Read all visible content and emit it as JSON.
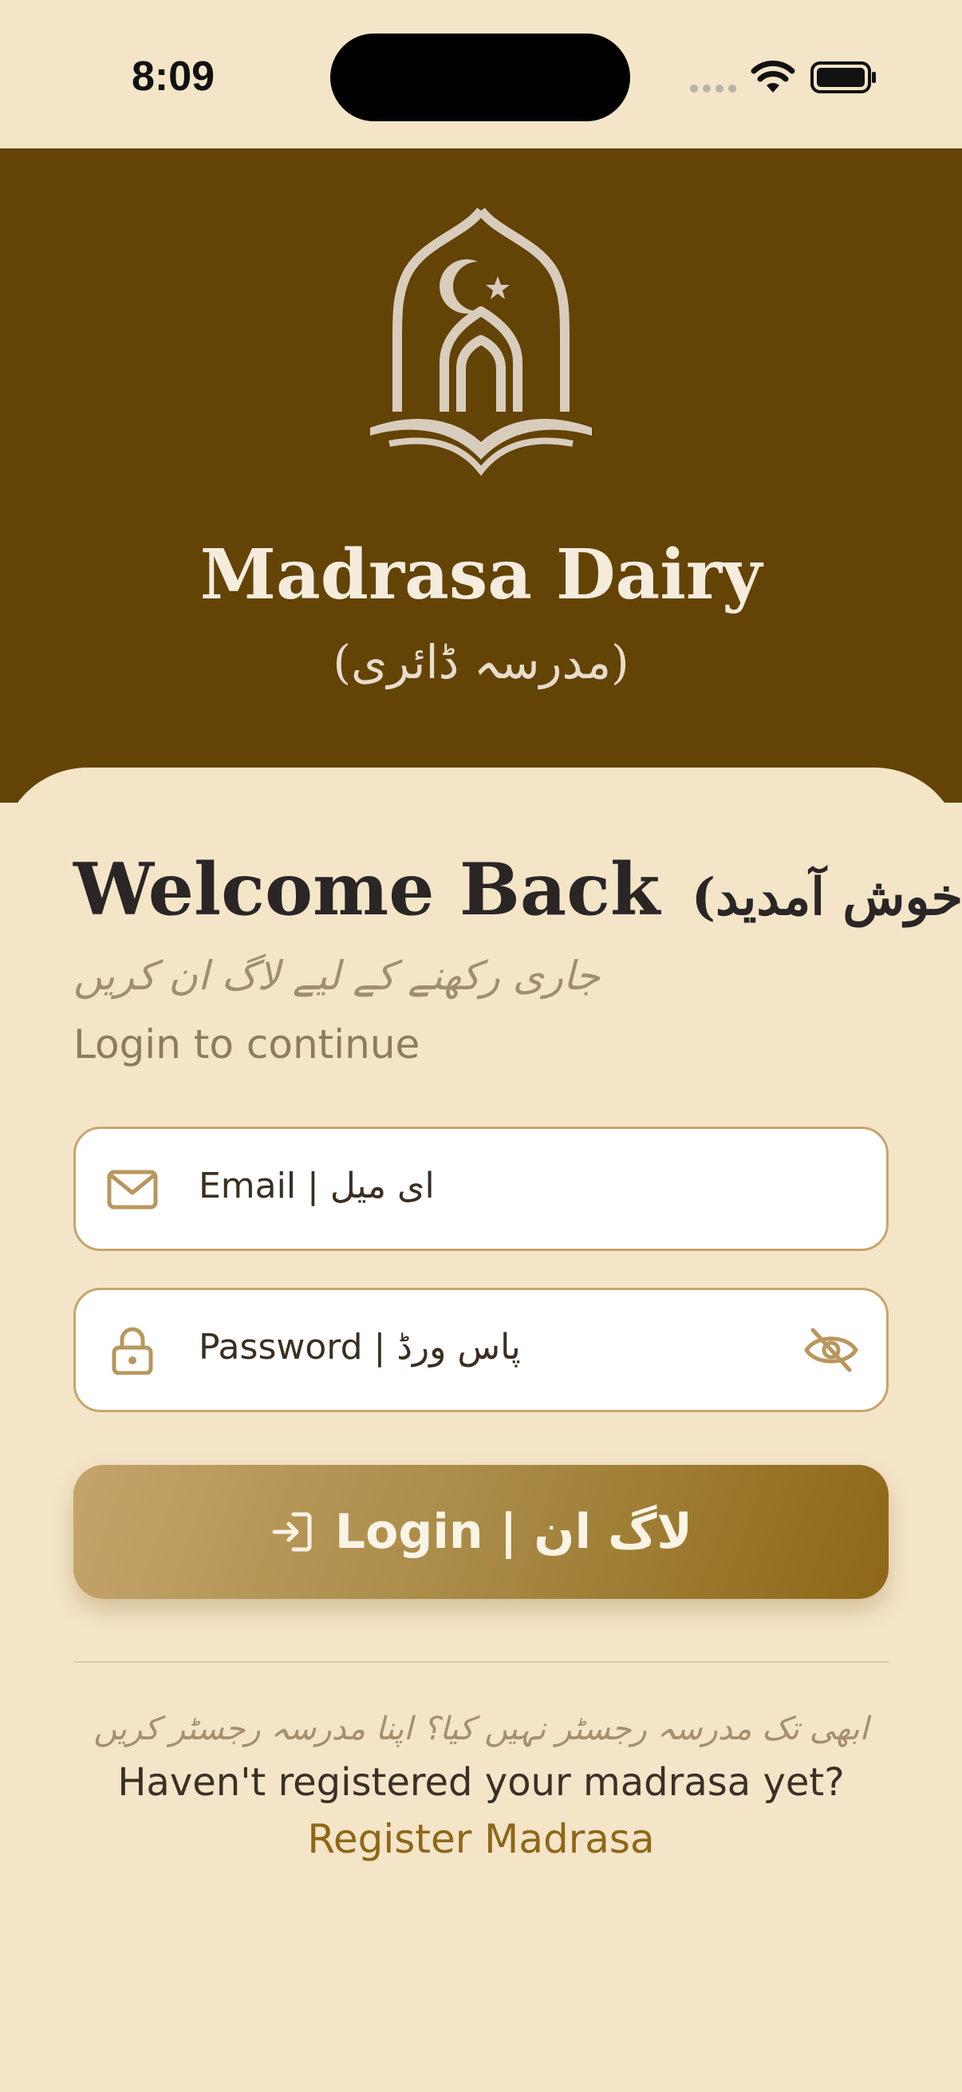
{
  "status_bar": {
    "time": "8:09"
  },
  "header": {
    "app_title": "Madrasa Dairy",
    "app_subtitle": "(مدرسہ ڈائری)"
  },
  "login": {
    "welcome_title": "Welcome Back",
    "welcome_urdu": "(خوش آمدید)",
    "urdu_subtitle": "جاری رکھنے کے لیے لاگ ان کریں",
    "subtitle": "Login to continue",
    "email_label": "Email | ای میل",
    "password_label": "Password | پاس ورڈ",
    "login_button": "Login  |  لاگ ان"
  },
  "register": {
    "urdu_prompt": "ابھی تک مدرسہ رجسٹر نہیں کیا؟ اپنا مدرسہ رجسٹر کریں",
    "prompt": "Haven't registered your madrasa yet?",
    "link": "Register Madrasa"
  },
  "icons": {
    "logo": "mosque-book-logo",
    "email": "mail-icon",
    "password": "lock-icon",
    "toggle_visibility": "eye-off-icon",
    "login": "login-arrow-icon"
  },
  "colors": {
    "background": "#f5e5c8",
    "header": "#634306",
    "accent": "#8e6718",
    "field_border": "#c6a56e"
  }
}
